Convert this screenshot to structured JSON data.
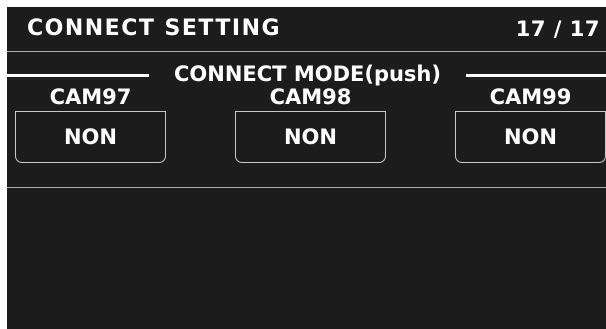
{
  "header": {
    "title": "CONNECT SETTING",
    "page": "17 / 17"
  },
  "section": {
    "title": "CONNECT MODE(push)"
  },
  "cameras": [
    {
      "label": "CAM97",
      "value": "NON"
    },
    {
      "label": "CAM98",
      "value": "NON"
    },
    {
      "label": "CAM99",
      "value": "NON"
    }
  ]
}
